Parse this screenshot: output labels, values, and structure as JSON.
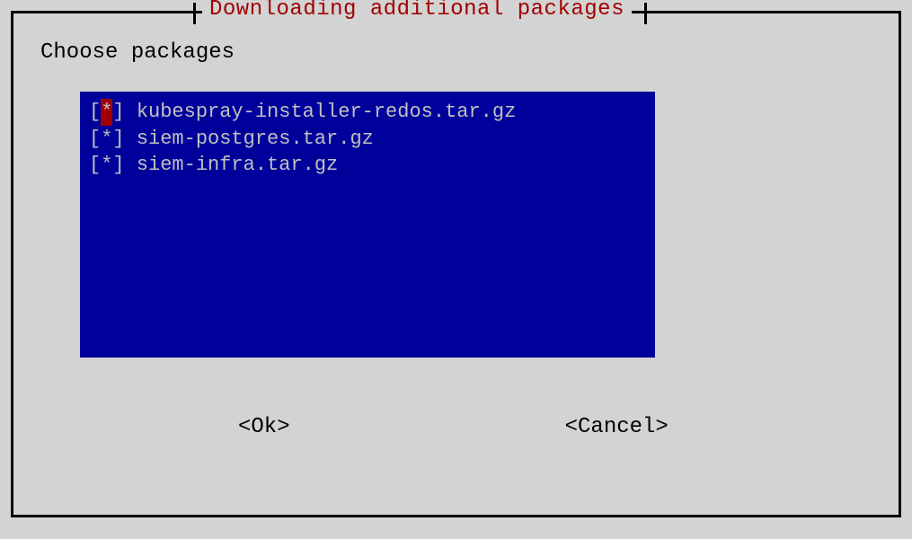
{
  "dialog": {
    "title": "Downloading additional packages",
    "prompt": "Choose packages",
    "items": [
      {
        "mark": "*",
        "label": "kubespray-installer-redos.tar.gz",
        "highlighted": true
      },
      {
        "mark": "*",
        "label": "siem-postgres.tar.gz",
        "highlighted": false
      },
      {
        "mark": "*",
        "label": "siem-infra.tar.gz",
        "highlighted": false
      }
    ],
    "buttons": {
      "ok": "<Ok>",
      "cancel": "<Cancel>"
    }
  }
}
